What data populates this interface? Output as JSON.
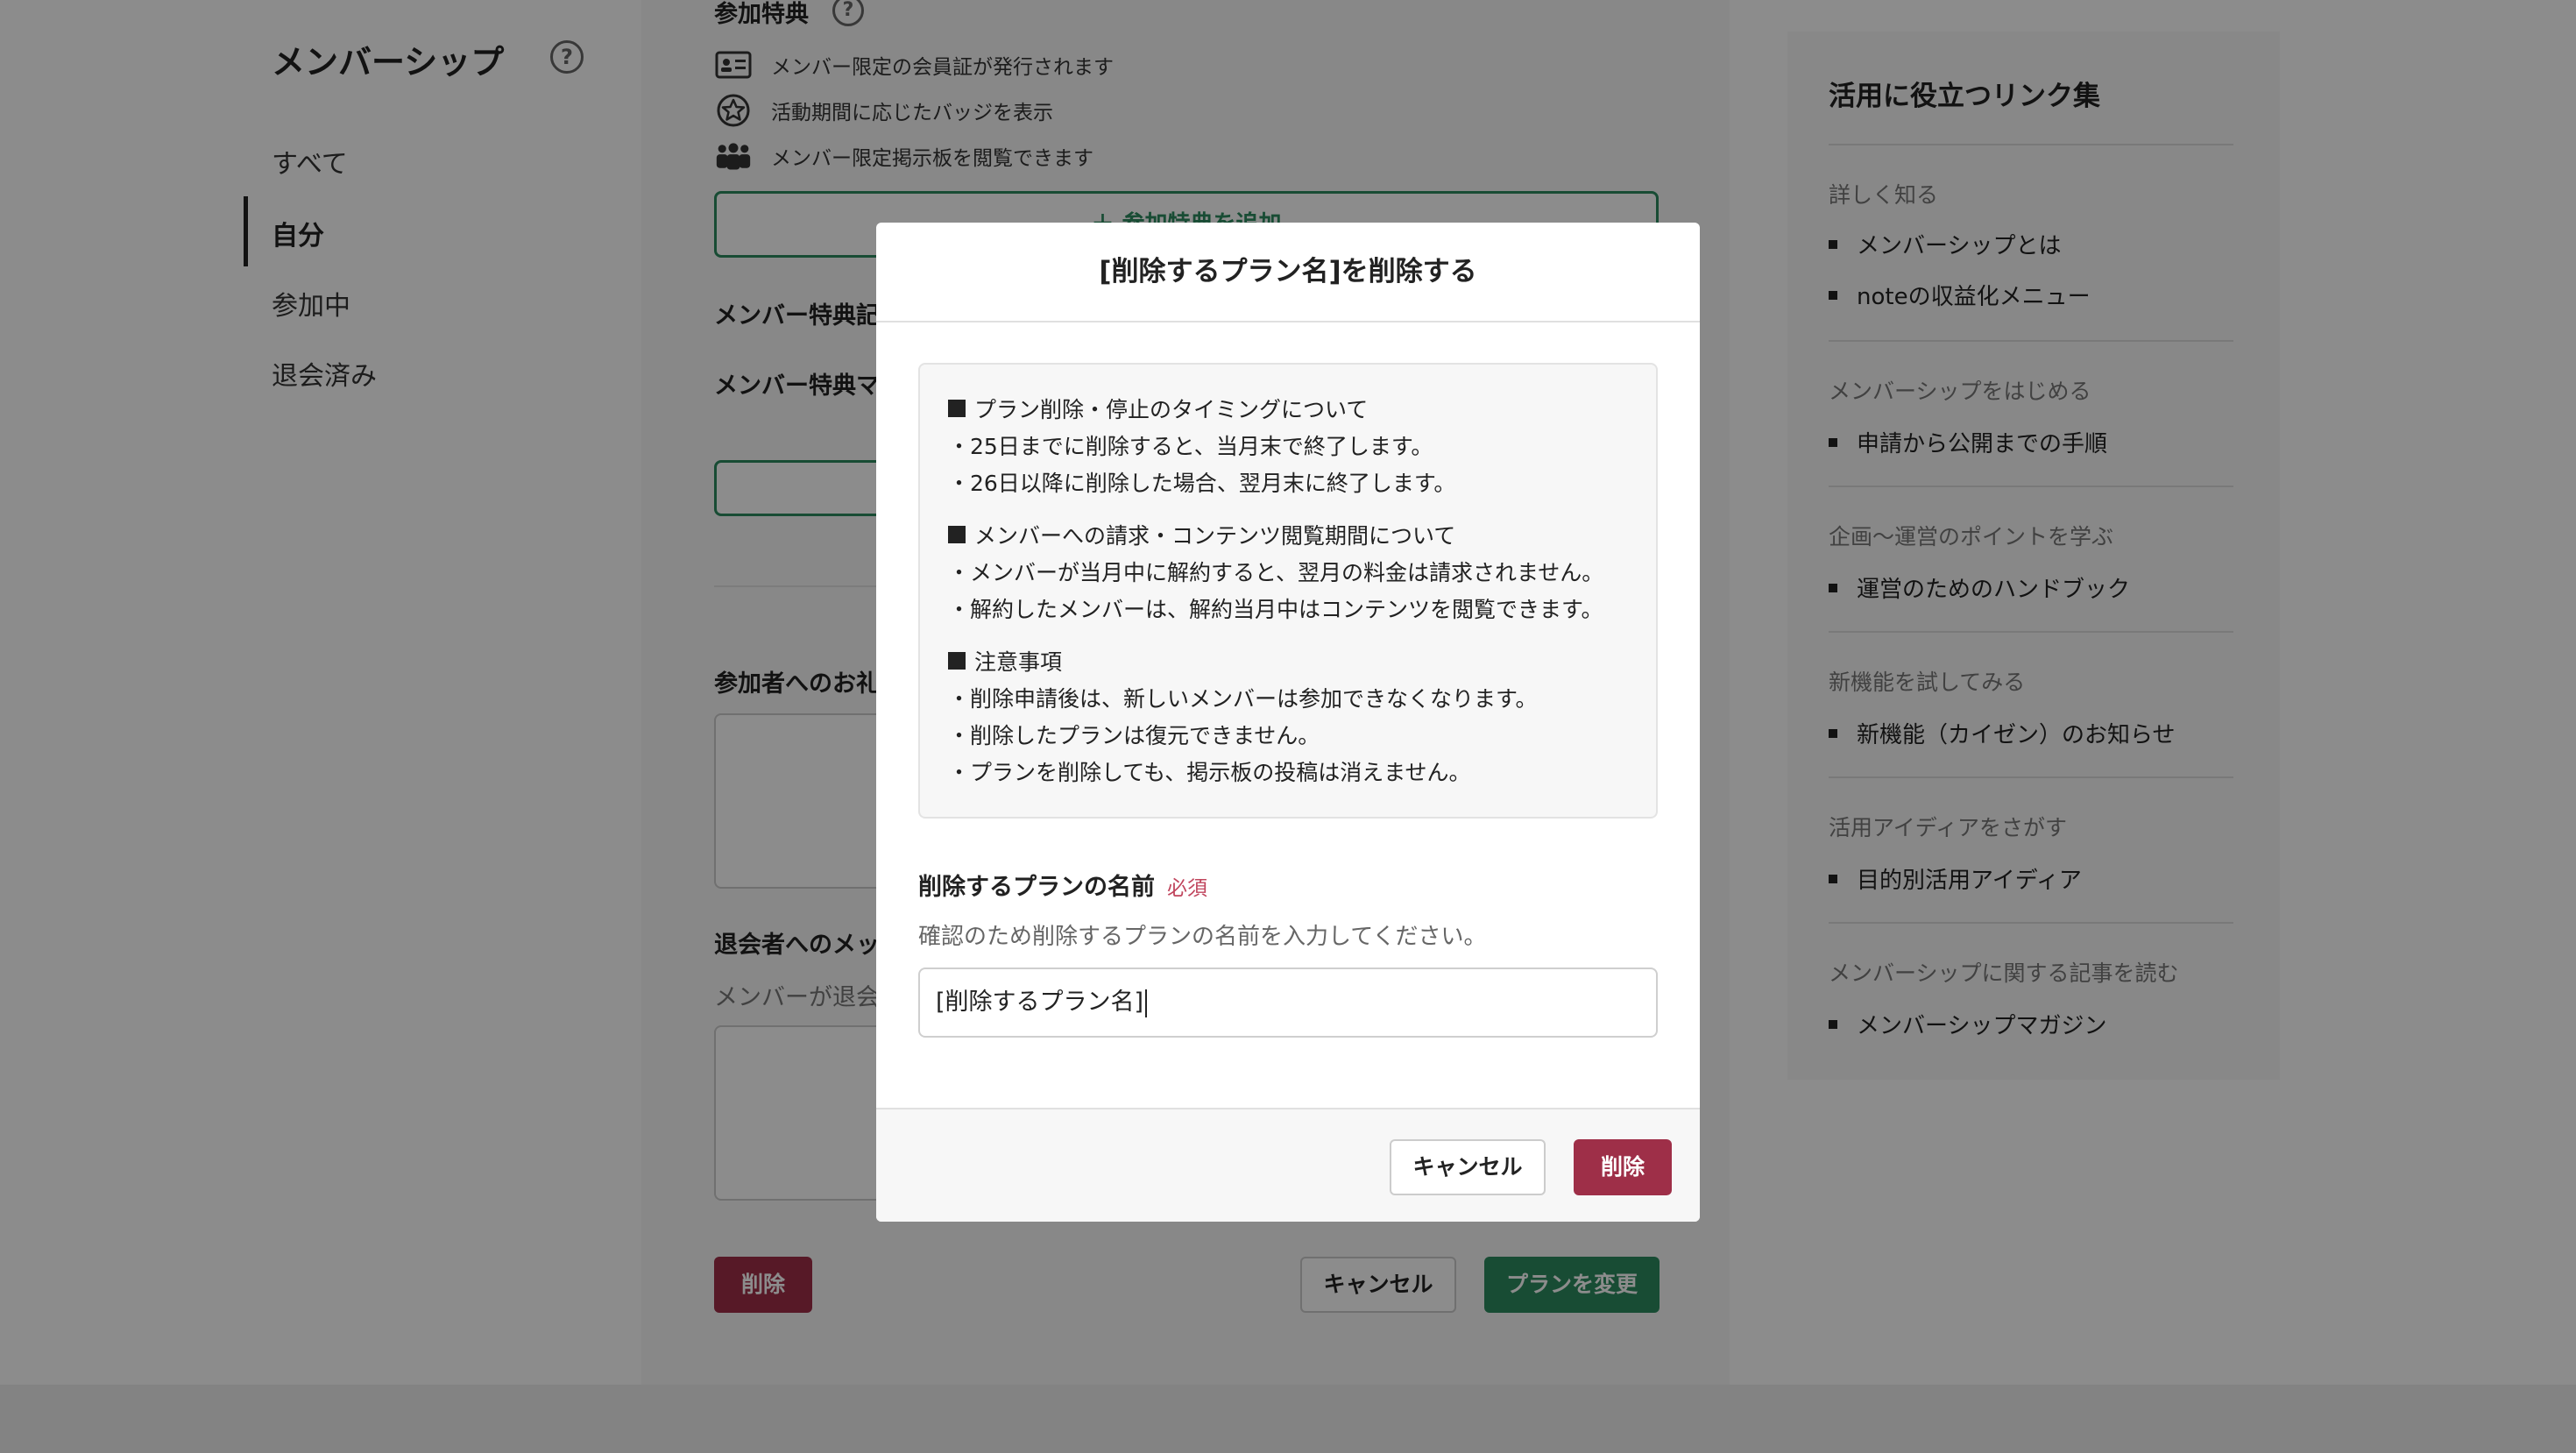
{
  "left_nav": {
    "title": "メンバーシップ",
    "items": [
      {
        "label": "すべて",
        "active": false
      },
      {
        "label": "自分",
        "active": true
      },
      {
        "label": "参加中",
        "active": false
      },
      {
        "label": "退会済み",
        "active": false
      }
    ]
  },
  "main": {
    "perks_title": "参加特典",
    "perks": [
      {
        "icon": "id-card-icon",
        "label": "メンバー限定の会員証が発行されます"
      },
      {
        "icon": "badge-star-icon",
        "label": "活動期間に応じたバッジを表示"
      },
      {
        "icon": "people-icon",
        "label": "メンバー限定掲示板を閲覧できます"
      }
    ],
    "add_perk_label": "＋ 参加特典を追加",
    "article_title": "メンバー特典記",
    "magazine_title": "メンバー特典マ",
    "welcome_title": "参加者へのお礼",
    "exit_title": "退会者へのメッ",
    "exit_help": "メンバーが退会",
    "delete_label": "削除",
    "cancel_label": "キャンセル",
    "change_label": "プランを変更"
  },
  "right_panel": {
    "title": "活用に役立つリンク集",
    "groups": [
      {
        "category": "詳しく知る",
        "links": [
          "メンバーシップとは",
          "noteの収益化メニュー"
        ]
      },
      {
        "category": "メンバーシップをはじめる",
        "links": [
          "申請から公開までの手順"
        ]
      },
      {
        "category": "企画〜運営のポイントを学ぶ",
        "links": [
          "運営のためのハンドブック"
        ]
      },
      {
        "category": "新機能を試してみる",
        "links": [
          "新機能（カイゼン）のお知らせ"
        ]
      },
      {
        "category": "活用アイディアをさがす",
        "links": [
          "目的別活用アイディア"
        ]
      },
      {
        "category": "メンバーシップに関する記事を読む",
        "links": [
          "メンバーシップマガジン"
        ]
      }
    ]
  },
  "modal": {
    "title": "[削除するプラン名]を削除する",
    "notice": [
      {
        "heading": "プラン削除・停止のタイミングについて",
        "lines": [
          "・25日までに削除すると、当月末で終了します。",
          "・26日以降に削除した場合、翌月末に終了します。"
        ]
      },
      {
        "heading": "メンバーへの請求・コンテンツ閲覧期間について",
        "lines": [
          "・メンバーが当月中に解約すると、翌月の料金は請求されません。",
          "・解約したメンバーは、解約当月中はコンテンツを閲覧できます。"
        ]
      },
      {
        "heading": "注意事項",
        "lines": [
          "・削除申請後は、新しいメンバーは参加できなくなります。",
          "・削除したプランは復元できません。",
          "・プランを削除しても、掲示板の投稿は消えません。"
        ]
      }
    ],
    "field_label": "削除するプランの名前",
    "required_label": "必須",
    "field_help": "確認のため削除するプランの名前を入力してください。",
    "input_value": "[削除するプラン名]",
    "cancel_label": "キャンセル",
    "delete_label": "削除"
  },
  "colors": {
    "accent_green": "#2c8b5f",
    "danger": "#9e2f48",
    "required": "#c0455d"
  }
}
